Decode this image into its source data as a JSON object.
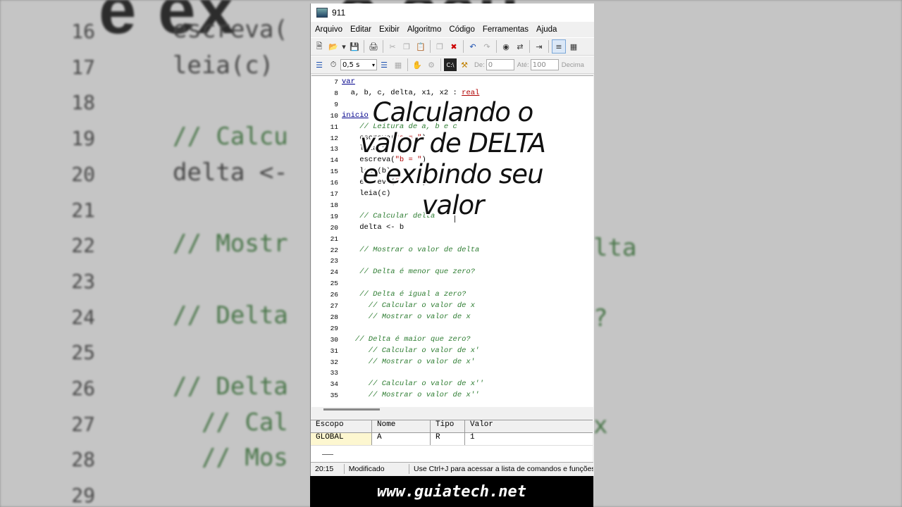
{
  "background": {
    "top_text": "e ex     o seu",
    "rows": [
      {
        "n": "16",
        "code": "escreva(",
        "comment": false
      },
      {
        "n": "17",
        "code": "leia(c)",
        "comment": false
      },
      {
        "n": "18",
        "code": "",
        "comment": false
      },
      {
        "n": "19",
        "code": "// Calcu",
        "comment": true
      },
      {
        "n": "20",
        "code": "delta <-",
        "comment": false
      },
      {
        "n": "21",
        "code": "",
        "comment": false
      },
      {
        "n": "22",
        "code": "// Mostr",
        "comment": true
      },
      {
        "n": "23",
        "code": "",
        "comment": false
      },
      {
        "n": "24",
        "code": "// Delta",
        "comment": true
      },
      {
        "n": "25",
        "code": "",
        "comment": false
      },
      {
        "n": "26",
        "code": "// Delta",
        "comment": true
      },
      {
        "n": "27",
        "code": "  // Cal",
        "comment": true
      },
      {
        "n": "28",
        "code": "  // Mos",
        "comment": true
      },
      {
        "n": "29",
        "code": "",
        "comment": false
      }
    ],
    "right_fragments": [
      "lta",
      "?",
      "x"
    ]
  },
  "window": {
    "title": "911"
  },
  "menu": [
    "Arquivo",
    "Editar",
    "Exibir",
    "Algoritmo",
    "Código",
    "Ferramentas",
    "Ajuda"
  ],
  "toolbar2": {
    "speed": "0,5 s",
    "de_label": "De:",
    "de_value": "0",
    "ate_label": "Até:",
    "ate_value": "100",
    "decimal_label": "Decima"
  },
  "code": [
    {
      "n": "7",
      "segs": [
        [
          "kw",
          "var"
        ]
      ]
    },
    {
      "n": "8",
      "segs": [
        [
          "",
          "  a, b, c, delta, x1, x2 : "
        ],
        [
          "tp",
          "real"
        ]
      ]
    },
    {
      "n": "9",
      "segs": []
    },
    {
      "n": "10",
      "segs": [
        [
          "kw",
          "inicio"
        ]
      ]
    },
    {
      "n": "11",
      "segs": [
        [
          "cmt",
          "    // Leitura de a, b e c"
        ]
      ]
    },
    {
      "n": "12",
      "segs": [
        [
          "",
          "    escreva("
        ],
        [
          "str",
          "\"a = \""
        ],
        [
          "",
          ")"
        ]
      ]
    },
    {
      "n": "13",
      "segs": [
        [
          "",
          "    leia(a)"
        ]
      ]
    },
    {
      "n": "14",
      "segs": [
        [
          "",
          "    escreva("
        ],
        [
          "str",
          "\"b = \""
        ],
        [
          "",
          ")"
        ]
      ]
    },
    {
      "n": "15",
      "segs": [
        [
          "",
          "    leia(b)"
        ]
      ]
    },
    {
      "n": "16",
      "segs": [
        [
          "",
          "    escreva("
        ],
        [
          "str",
          "\"c = \""
        ],
        [
          "",
          ")"
        ]
      ]
    },
    {
      "n": "17",
      "segs": [
        [
          "",
          "    leia(c)"
        ]
      ]
    },
    {
      "n": "18",
      "segs": []
    },
    {
      "n": "19",
      "segs": [
        [
          "cmt",
          "    // Calcular delta"
        ]
      ]
    },
    {
      "n": "20",
      "segs": [
        [
          "",
          "    delta <- b"
        ]
      ]
    },
    {
      "n": "21",
      "segs": []
    },
    {
      "n": "22",
      "segs": [
        [
          "cmt",
          "    // Mostrar o valor de delta"
        ]
      ]
    },
    {
      "n": "23",
      "segs": []
    },
    {
      "n": "24",
      "segs": [
        [
          "cmt",
          "    // Delta é menor que zero?"
        ]
      ]
    },
    {
      "n": "25",
      "segs": []
    },
    {
      "n": "26",
      "segs": [
        [
          "cmt",
          "    // Delta é igual a zero?"
        ]
      ]
    },
    {
      "n": "27",
      "segs": [
        [
          "cmt",
          "      // Calcular o valor de x"
        ]
      ]
    },
    {
      "n": "28",
      "segs": [
        [
          "cmt",
          "      // Mostrar o valor de x"
        ]
      ]
    },
    {
      "n": "29",
      "segs": []
    },
    {
      "n": "30",
      "segs": [
        [
          "cmt",
          "   // Delta é maior que zero?"
        ]
      ]
    },
    {
      "n": "31",
      "segs": [
        [
          "cmt",
          "      // Calcular o valor de x'"
        ]
      ]
    },
    {
      "n": "32",
      "segs": [
        [
          "cmt",
          "      // Mostrar o valor de x'"
        ]
      ]
    },
    {
      "n": "33",
      "segs": []
    },
    {
      "n": "34",
      "segs": [
        [
          "cmt",
          "      // Calcular o valor de x''"
        ]
      ]
    },
    {
      "n": "35",
      "segs": [
        [
          "cmt",
          "      // Mostrar o valor de x''"
        ]
      ]
    }
  ],
  "vars": {
    "headers": [
      "Escopo",
      "Nome",
      "Tipo",
      "Valor"
    ],
    "rows": [
      [
        "GLOBAL",
        "A",
        "R",
        "1"
      ]
    ]
  },
  "status": {
    "pos": "20:15",
    "state": "Modificado",
    "hint": "Use Ctrl+J para acessar a lista de comandos e funções"
  },
  "overlay": {
    "lines": [
      "Calculando o",
      "valor de DELTA",
      "e exibindo seu",
      "valor"
    ]
  },
  "footer": "www.guiatech.net",
  "colors": {
    "comment": "#2e7d32",
    "keyword": "#00008b",
    "type": "#b00000",
    "footer_bg": "#000000"
  }
}
